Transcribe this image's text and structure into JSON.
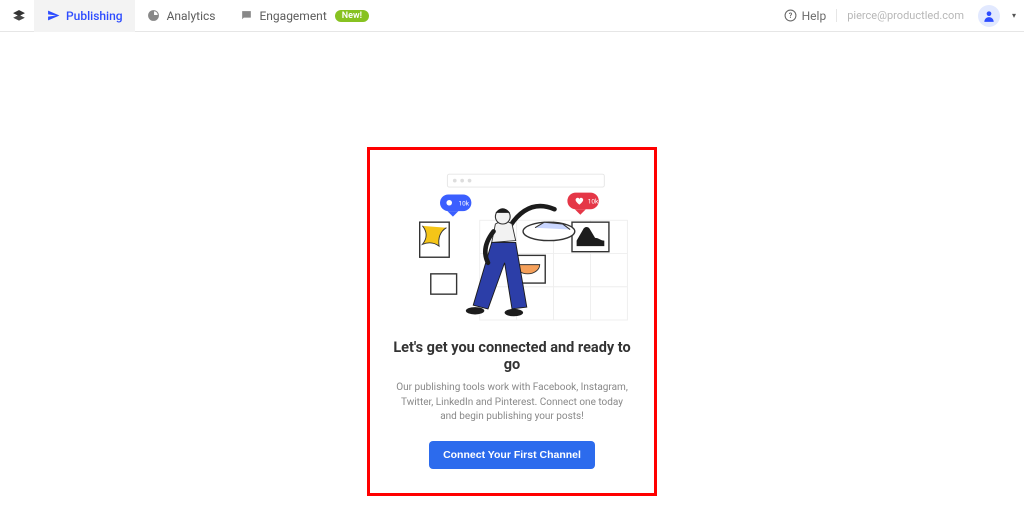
{
  "nav": {
    "publishing": "Publishing",
    "analytics": "Analytics",
    "engagement": "Engagement",
    "badge": "New!"
  },
  "header": {
    "help": "Help",
    "email": "pierce@productled.com"
  },
  "empty": {
    "title": "Let's get you connected and ready to go",
    "desc": "Our publishing tools work with Facebook, Instagram, Twitter, LinkedIn and Pinterest. Connect one today and begin publishing your posts!",
    "cta": "Connect Your First Channel"
  }
}
